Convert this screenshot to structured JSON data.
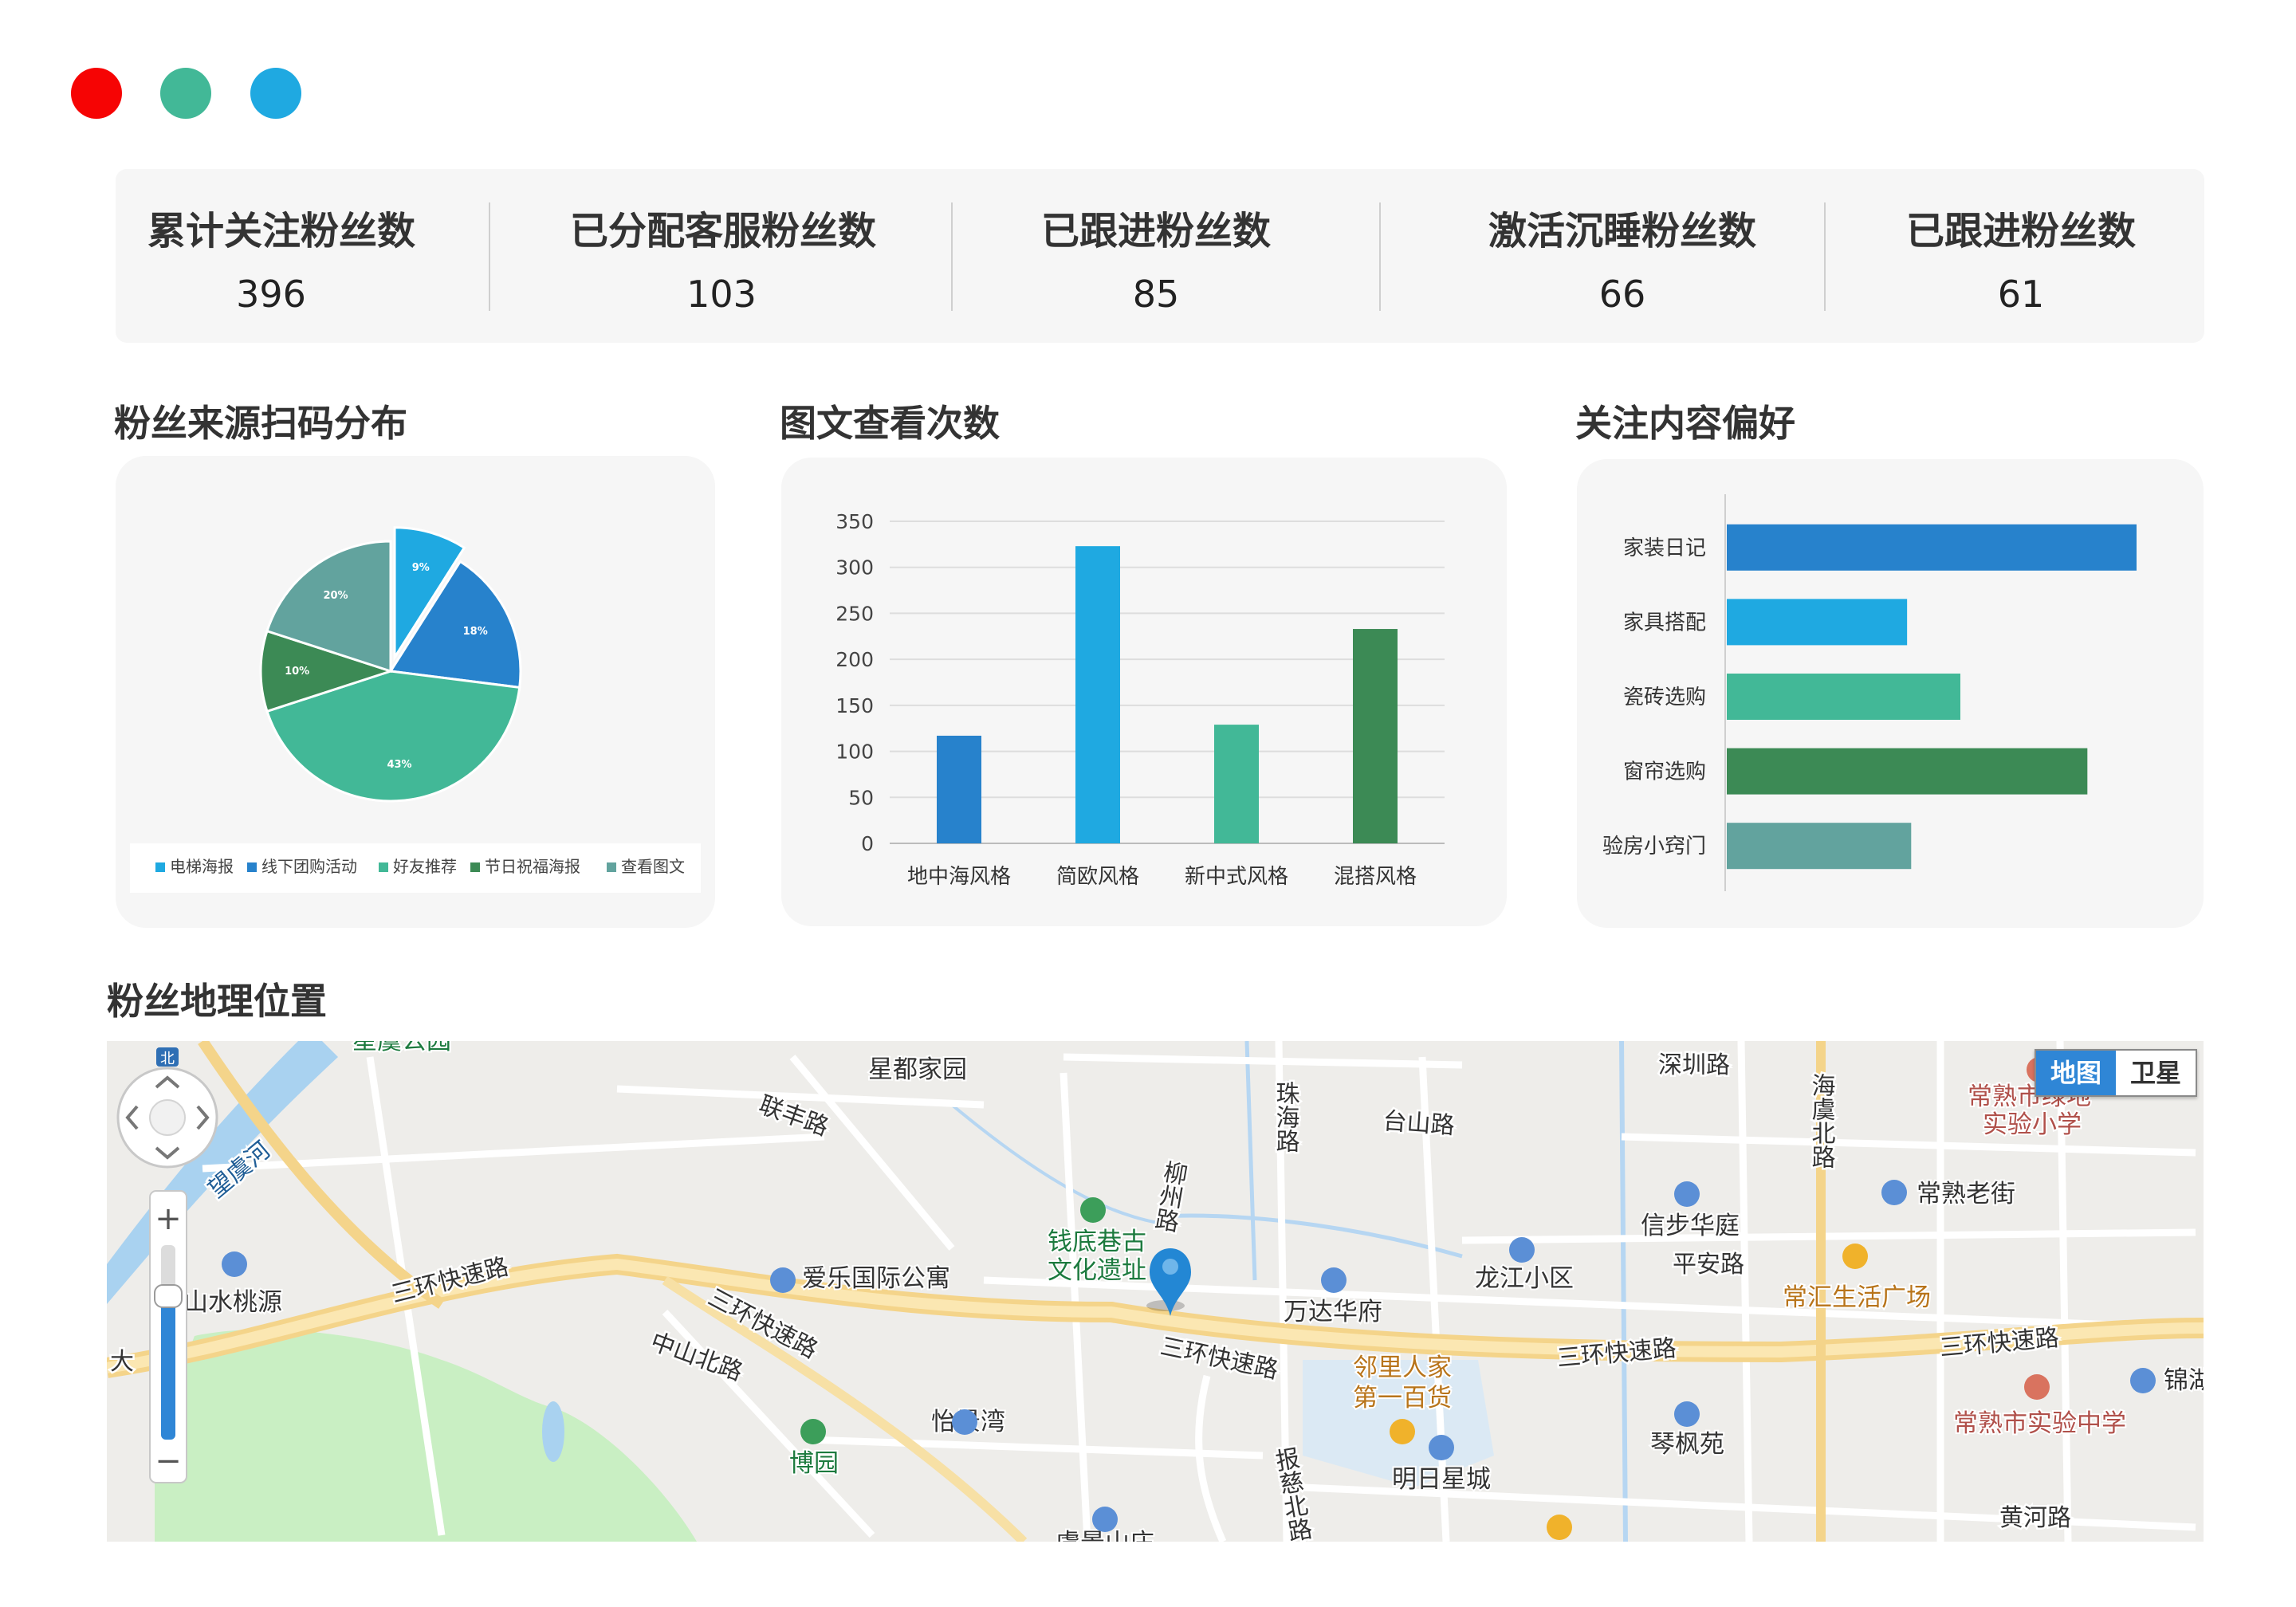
{
  "window_dots": [
    {
      "name": "close",
      "color": "#f60404"
    },
    {
      "name": "minimize",
      "color": "#42b897"
    },
    {
      "name": "maximize",
      "color": "#1fa9e1"
    }
  ],
  "stats": [
    {
      "label": "累计关注粉丝数",
      "value": "396"
    },
    {
      "label": "已分配客服粉丝数",
      "value": "103"
    },
    {
      "label": "已跟进粉丝数",
      "value": "85"
    },
    {
      "label": "激活沉睡粉丝数",
      "value": "66"
    },
    {
      "label": "已跟进粉丝数",
      "value": "61"
    }
  ],
  "sections": {
    "pie_title": "粉丝来源扫码分布",
    "bar_title": "图文查看次数",
    "hbar_title": "关注内容偏好",
    "map_title": "粉丝地理位置"
  },
  "chart_data": [
    {
      "type": "pie",
      "title": "粉丝来源扫码分布",
      "slices": [
        {
          "name": "电梯海报",
          "value": 9,
          "label": "9%",
          "color": "#1fa9e1",
          "exploded": true
        },
        {
          "name": "线下团购活动",
          "value": 18,
          "label": "18%",
          "color": "#2782cc"
        },
        {
          "name": "好友推荐",
          "value": 43,
          "label": "43%",
          "color": "#42b897"
        },
        {
          "name": "节日祝福海报",
          "value": 10,
          "label": "10%",
          "color": "#3c8a55"
        },
        {
          "name": "查看图文",
          "value": 20,
          "label": "20%",
          "color": "#62a39e"
        }
      ],
      "legend_position": "bottom"
    },
    {
      "type": "bar",
      "title": "图文查看次数",
      "categories": [
        "地中海风格",
        "简欧风格",
        "新中式风格",
        "混搭风格"
      ],
      "values": [
        117,
        323,
        129,
        233
      ],
      "colors": [
        "#2782cc",
        "#1fa9e1",
        "#42b897",
        "#3c8a55"
      ],
      "ylim": [
        0,
        350
      ],
      "yticks": [
        0,
        50,
        100,
        150,
        200,
        250,
        300,
        350
      ],
      "grid": true
    },
    {
      "type": "bar",
      "orientation": "horizontal",
      "title": "关注内容偏好",
      "categories": [
        "家装日记",
        "家具搭配",
        "瓷砖选购",
        "窗帘选购",
        "验房小窍门"
      ],
      "values": [
        100,
        44,
        57,
        88,
        45
      ],
      "colors": [
        "#2782cc",
        "#1fa9e1",
        "#42b897",
        "#3c8a55",
        "#62a39e"
      ],
      "xlim": [
        0,
        100
      ]
    }
  ],
  "map": {
    "toggle": {
      "map": "地图",
      "satellite": "卫星",
      "active": "map"
    },
    "controls": {
      "compass": "北",
      "zoom_in": "+",
      "zoom_out": "−"
    },
    "roads": [
      {
        "name": "三环快速路"
      },
      {
        "name": "三环快速路"
      },
      {
        "name": "三环快速路"
      },
      {
        "name": "三环快速路"
      },
      {
        "name": "三环快速路"
      },
      {
        "name": "中山北路"
      },
      {
        "name": "联丰路"
      },
      {
        "name": "台山路"
      },
      {
        "name": "深圳路"
      },
      {
        "name": "平安路"
      },
      {
        "name": "黄河路"
      },
      {
        "name": "望虞河"
      },
      {
        "name": "大"
      }
    ],
    "vertical_roads": [
      {
        "name": "珠海路"
      },
      {
        "name": "柳州路"
      },
      {
        "name": "海虞北路"
      },
      {
        "name": "报慈北路"
      }
    ],
    "places": [
      {
        "name": "星都家园",
        "kind": "house"
      },
      {
        "name": "钱底巷古",
        "kind": "scenic"
      },
      {
        "name": "文化遗址",
        "kind": "scenic"
      },
      {
        "name": "爱乐国际公寓",
        "kind": "house"
      },
      {
        "name": "山水桃源",
        "kind": "house"
      },
      {
        "name": "怡景湾",
        "kind": "house"
      },
      {
        "name": "博园",
        "kind": "park"
      },
      {
        "name": "万达华府",
        "kind": "house"
      },
      {
        "name": "龙江小区",
        "kind": "house"
      },
      {
        "name": "信步华庭",
        "kind": "house"
      },
      {
        "name": "邻里人家",
        "kind": "shop"
      },
      {
        "name": "第一百货",
        "kind": "shop"
      },
      {
        "name": "明日星城",
        "kind": "house"
      },
      {
        "name": "琴枫苑",
        "kind": "house"
      },
      {
        "name": "常汇生活广场",
        "kind": "shop"
      },
      {
        "name": "常熟老街",
        "kind": "house"
      },
      {
        "name": "常熟市绿地",
        "kind": "school"
      },
      {
        "name": "实验小学",
        "kind": "school"
      },
      {
        "name": "常熟市实验中学",
        "kind": "school"
      },
      {
        "name": "锦湖",
        "kind": "house"
      },
      {
        "name": "星虞公园",
        "kind": "park"
      },
      {
        "name": "虞景山庄",
        "kind": "house"
      }
    ]
  }
}
